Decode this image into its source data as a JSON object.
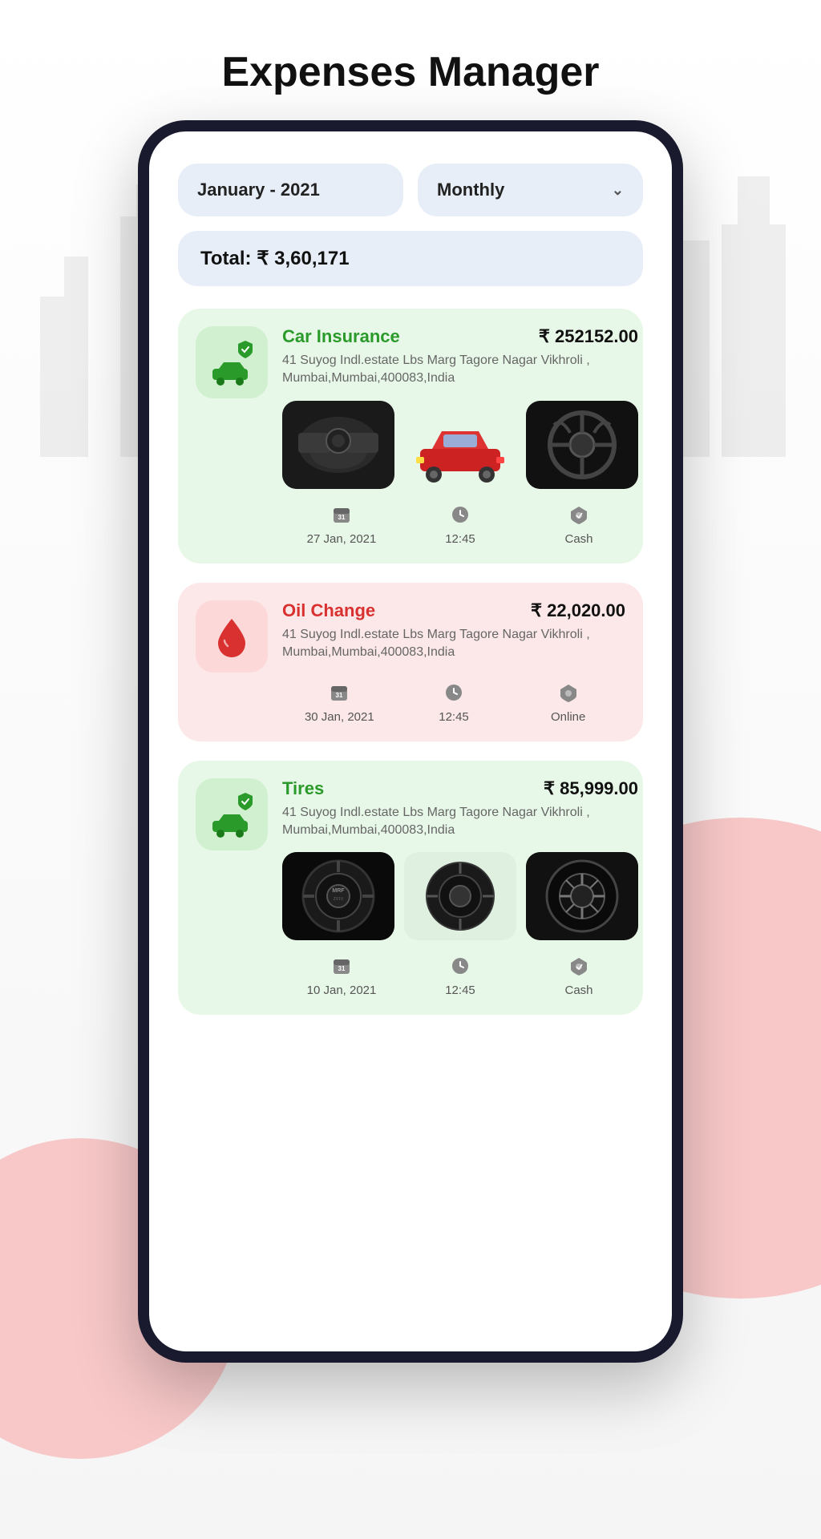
{
  "page": {
    "title": "Expenses Manager"
  },
  "header": {
    "date_label": "January - 2021",
    "period_label": "Monthly",
    "total_label": "Total: ₹ 3,60,171"
  },
  "expenses": [
    {
      "id": "car-insurance",
      "title": "Car Insurance",
      "amount": "₹ 252152.00",
      "address": "41 Suyog Indl.estate Lbs Marg Tagore Nagar Vikhroli , Mumbai,Mumbai,400083,India",
      "date": "27 Jan, 2021",
      "time": "12:45",
      "payment": "Cash",
      "color": "green",
      "icon_type": "car-shield",
      "has_images": true
    },
    {
      "id": "oil-change",
      "title": "Oil Change",
      "amount": "₹ 22,020.00",
      "address": "41 Suyog Indl.estate Lbs Marg Tagore Nagar Vikhroli , Mumbai,Mumbai,400083,India",
      "date": "30 Jan, 2021",
      "time": "12:45",
      "payment": "Online",
      "color": "red",
      "icon_type": "oil-drop",
      "has_images": false
    },
    {
      "id": "tires",
      "title": "Tires",
      "amount": "₹ 85,999.00",
      "address": "41 Suyog Indl.estate Lbs Marg Tagore Nagar Vikhroli , Mumbai,Mumbai,400083,India",
      "date": "10 Jan, 2021",
      "time": "12:45",
      "payment": "Cash",
      "color": "green",
      "icon_type": "car-shield",
      "has_images": true
    }
  ],
  "icons": {
    "calendar": "📅",
    "clock": "🕐",
    "payment": "💰",
    "chevron_down": "⌄"
  }
}
